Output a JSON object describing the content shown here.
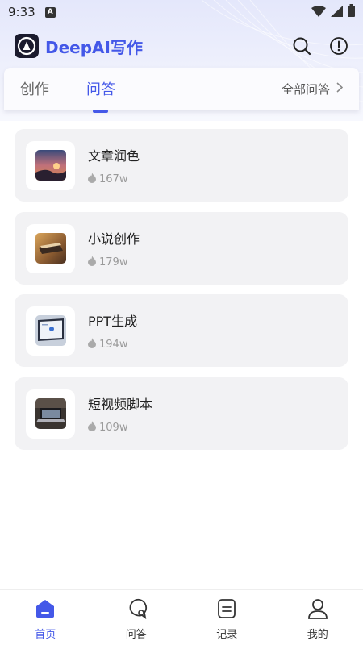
{
  "status_bar": {
    "time": "9:33",
    "notification_badge": "A"
  },
  "header": {
    "app_title": "DeepAI写作",
    "icons": [
      "search-icon",
      "info-icon"
    ]
  },
  "tabs": [
    {
      "label": "创作",
      "active": false
    },
    {
      "label": "问答",
      "active": true
    }
  ],
  "all_qa_label": "全部问答",
  "items": [
    {
      "title": "文章润色",
      "count": "167w",
      "icon": "fire-icon"
    },
    {
      "title": "小说创作",
      "count": "179w",
      "icon": "fire-icon"
    },
    {
      "title": "PPT生成",
      "count": "194w",
      "icon": "fire-icon"
    },
    {
      "title": "短视频脚本",
      "count": "109w",
      "icon": "fire-icon"
    }
  ],
  "bottom_nav": [
    {
      "label": "首页",
      "icon": "home-icon",
      "active": true
    },
    {
      "label": "问答",
      "icon": "chat-icon",
      "active": false
    },
    {
      "label": "记录",
      "icon": "record-icon",
      "active": false
    },
    {
      "label": "我的",
      "icon": "user-icon",
      "active": false
    }
  ],
  "colors": {
    "accent": "#4458e8",
    "card_bg": "#f2f2f4"
  }
}
